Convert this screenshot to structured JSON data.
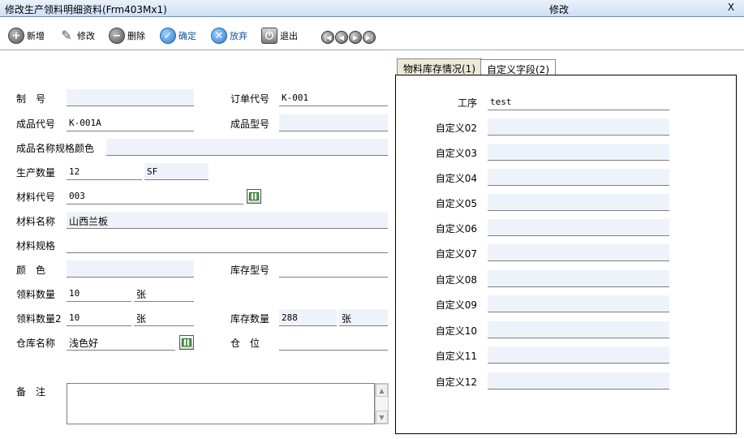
{
  "window": {
    "title": "修改生产领料明细资料(Frm403Mx1)",
    "mode": "修改",
    "close_label": "X"
  },
  "toolbar": {
    "add": "新增",
    "edit": "修改",
    "delete": "删除",
    "confirm": "确定",
    "cancel": "放弃",
    "exit": "退出"
  },
  "form": {
    "zhihao": {
      "label": "制　号",
      "value": ""
    },
    "order_code": {
      "label": "订单代号",
      "value": "K-001"
    },
    "product_code": {
      "label": "成品代号",
      "value": "K-001A"
    },
    "product_model": {
      "label": "成品型号",
      "value": ""
    },
    "product_name_spec_color": {
      "label": "成品名称规格颜色",
      "value": ""
    },
    "prod_qty": {
      "label": "生产数量",
      "value": "12",
      "unit": "SF"
    },
    "material_code": {
      "label": "材料代号",
      "value": "003"
    },
    "material_name": {
      "label": "材料名称",
      "value": "山西兰板"
    },
    "material_spec": {
      "label": "材料规格",
      "value": ""
    },
    "color": {
      "label": "颜　色",
      "value": ""
    },
    "stock_model": {
      "label": "库存型号",
      "value": ""
    },
    "issue_qty": {
      "label": "领料数量",
      "value": "10",
      "unit": "张"
    },
    "issue_qty2": {
      "label": "领料数量2",
      "value": "10",
      "unit": "张"
    },
    "stock_qty": {
      "label": "库存数量",
      "value": "288",
      "unit": "张"
    },
    "warehouse": {
      "label": "仓库名称",
      "value": "浅色好"
    },
    "location": {
      "label": "仓　位",
      "value": ""
    },
    "remark": {
      "label": "备　注",
      "value": ""
    }
  },
  "tabs": {
    "stock": "物料库存情况(1)",
    "custom": "自定义字段(2)"
  },
  "custom_fields": [
    {
      "label": "工序",
      "value": "test"
    },
    {
      "label": "自定义02",
      "value": ""
    },
    {
      "label": "自定义03",
      "value": ""
    },
    {
      "label": "自定义04",
      "value": ""
    },
    {
      "label": "自定义05",
      "value": ""
    },
    {
      "label": "自定义06",
      "value": ""
    },
    {
      "label": "自定义07",
      "value": ""
    },
    {
      "label": "自定义08",
      "value": ""
    },
    {
      "label": "自定义09",
      "value": ""
    },
    {
      "label": "自定义10",
      "value": ""
    },
    {
      "label": "自定义11",
      "value": ""
    },
    {
      "label": "自定义12",
      "value": ""
    }
  ]
}
